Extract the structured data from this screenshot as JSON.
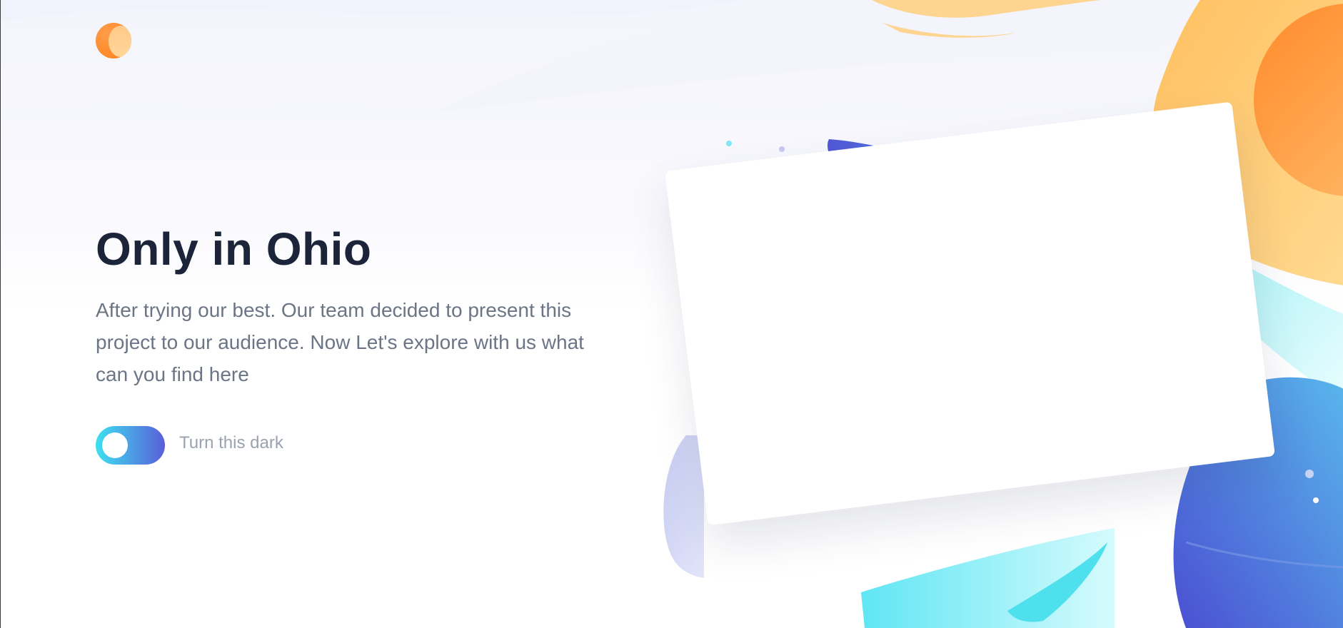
{
  "hero": {
    "title": "Only in Ohio",
    "description": "After trying our best. Our team decided to present this project to our audience. Now Let's explore with us what can you find here"
  },
  "theme_toggle": {
    "label": "Turn this dark",
    "state": "off"
  },
  "colors": {
    "title": "#1b2438",
    "description": "#6b7586",
    "toggle_label": "#9aa3b0",
    "toggle_gradient_start": "#3fe0f0",
    "toggle_gradient_end": "#5a5fd8",
    "accent_orange": "#ff8a2b",
    "accent_yellow": "#ffc76a",
    "accent_blue": "#4f5bd5",
    "accent_cyan": "#5eeaf2"
  },
  "icons": {
    "logo": "orange-moon-logo-icon"
  }
}
